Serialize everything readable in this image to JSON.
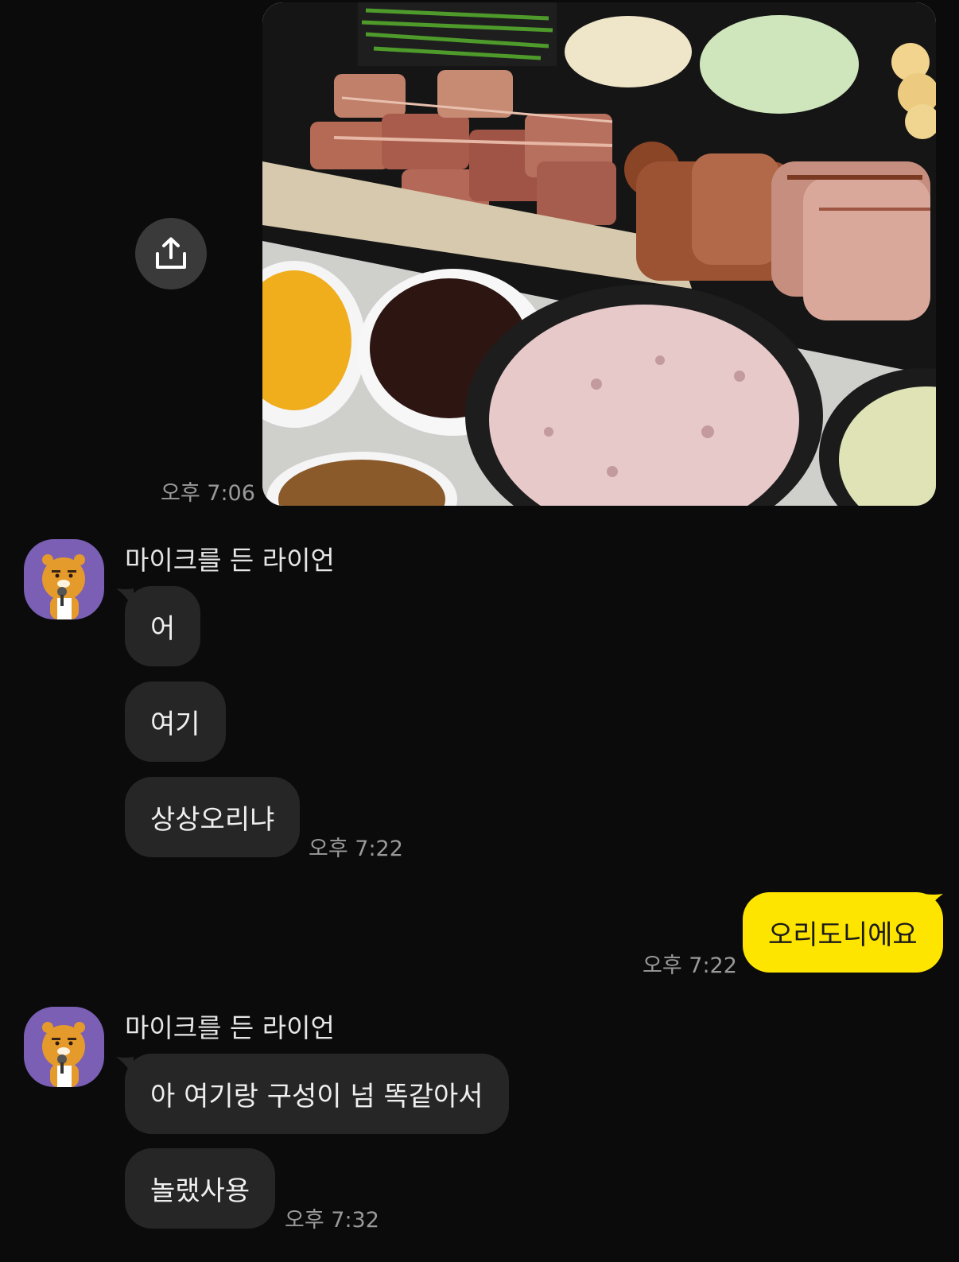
{
  "messages": {
    "photo": {
      "time": "오후 7:06"
    },
    "group1": {
      "sender": "마이크를 든 라이언",
      "bubbles": [
        "어",
        "여기",
        "상상오리냐"
      ],
      "time": "오후 7:22"
    },
    "mine1": {
      "text": "오리도니에요",
      "time": "오후 7:22"
    },
    "group2": {
      "sender": "마이크를 든 라이언",
      "bubbles": [
        "아 여기랑 구성이 넘 똑같아서",
        "놀랬사용"
      ],
      "time": "오후 7:32"
    }
  },
  "icons": {
    "share": "share-upload-icon",
    "avatar": "ryan-with-microphone-avatar"
  },
  "colors": {
    "background": "#0b0b0b",
    "incoming_bubble": "#262626",
    "outgoing_bubble": "#fee500",
    "avatar_bg": "#7a5fb4",
    "timestamp": "#9a9a9a"
  }
}
